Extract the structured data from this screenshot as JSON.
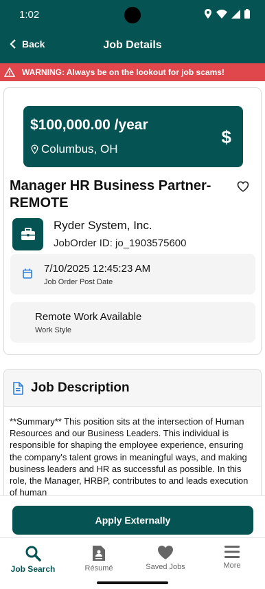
{
  "status": {
    "time": "1:02"
  },
  "appbar": {
    "back_label": "Back",
    "title": "Job Details"
  },
  "warning": {
    "text": "WARNING: Always be on the lookout for job scams!"
  },
  "job": {
    "salary": "$100,000.00 /year",
    "location": "Columbus, OH",
    "currency_symbol": "$",
    "title": "Manager HR Business Partner-REMOTE",
    "company": "Ryder System, Inc.",
    "job_order": "JobOrder ID: jo_1903575600",
    "post_date": "7/10/2025 12:45:23 AM",
    "post_date_label": "Job Order Post Date",
    "work_style": "Remote Work Available",
    "work_style_label": "Work Style"
  },
  "description": {
    "title": "Job Description",
    "text": "**Summary** This position sits at the intersection of Human Resources and our Business Leaders. This individual is responsible for shaping the employee experience, ensuring the company's talent grows in meaningful ways, and making business leaders and HR as successful as possible. In this role, the Manager, HRBP, contributes to and leads execution of human"
  },
  "apply": {
    "label": "Apply Externally"
  },
  "tabs": [
    {
      "label": "Job Search",
      "icon": "search-icon"
    },
    {
      "label": "Résumé",
      "icon": "resume-icon"
    },
    {
      "label": "Saved Jobs",
      "icon": "heart-icon"
    },
    {
      "label": "More",
      "icon": "menu-icon"
    }
  ],
  "colors": {
    "primary": "#055352",
    "warning": "#e0474c"
  }
}
